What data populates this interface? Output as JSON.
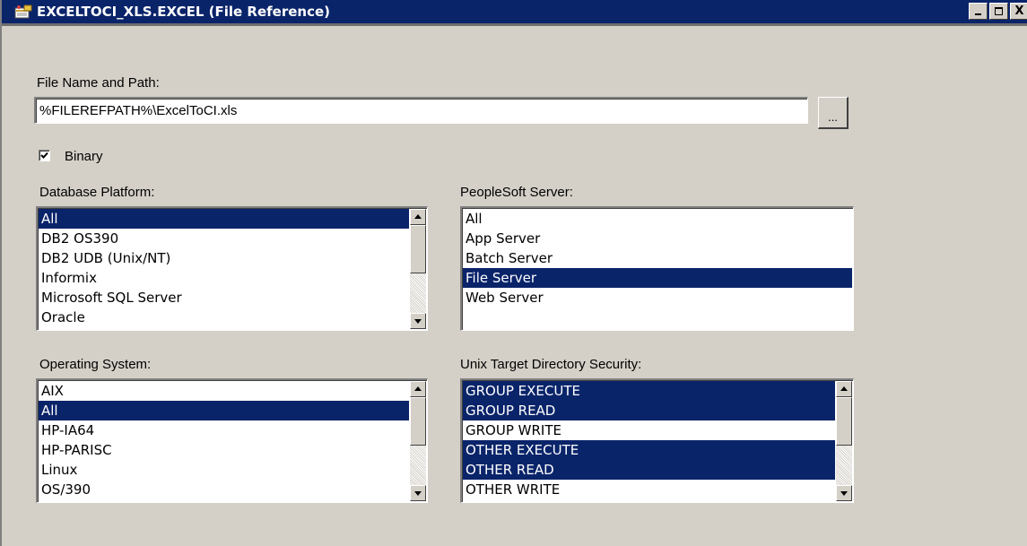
{
  "window": {
    "title": "EXCELTOCI_XLS.EXCEL (File Reference)",
    "controls": {
      "minimize": "_",
      "restore": "□",
      "close": "X"
    }
  },
  "file": {
    "label": "File Name and Path:",
    "value": "%FILEREFPATH%\\ExcelToCI.xls",
    "browse_label": "..."
  },
  "binary": {
    "label": "Binary",
    "checked": true
  },
  "database_platform": {
    "label": "Database Platform:",
    "items": [
      {
        "label": "All",
        "selected": true
      },
      {
        "label": "DB2 OS390",
        "selected": false
      },
      {
        "label": "DB2 UDB (Unix/NT)",
        "selected": false
      },
      {
        "label": "Informix",
        "selected": false
      },
      {
        "label": "Microsoft SQL Server",
        "selected": false
      },
      {
        "label": "Oracle",
        "selected": false
      }
    ]
  },
  "peoplesoft_server": {
    "label": "PeopleSoft Server:",
    "items": [
      {
        "label": "All",
        "selected": false
      },
      {
        "label": "App Server",
        "selected": false
      },
      {
        "label": "Batch Server",
        "selected": false
      },
      {
        "label": "File Server",
        "selected": true
      },
      {
        "label": "Web Server",
        "selected": false
      }
    ]
  },
  "operating_system": {
    "label": "Operating System:",
    "items": [
      {
        "label": "AIX",
        "selected": false
      },
      {
        "label": "All",
        "selected": true
      },
      {
        "label": "HP-IA64",
        "selected": false
      },
      {
        "label": "HP-PARISC",
        "selected": false
      },
      {
        "label": "Linux",
        "selected": false
      },
      {
        "label": "OS/390",
        "selected": false
      }
    ]
  },
  "unix_security": {
    "label": "Unix Target Directory Security:",
    "items": [
      {
        "label": "GROUP EXECUTE",
        "selected": true
      },
      {
        "label": "GROUP READ",
        "selected": true
      },
      {
        "label": "GROUP WRITE",
        "selected": false
      },
      {
        "label": "OTHER EXECUTE",
        "selected": true
      },
      {
        "label": "OTHER READ",
        "selected": true
      },
      {
        "label": "OTHER WRITE",
        "selected": false
      }
    ]
  },
  "colors": {
    "selection": "#0a246a",
    "dialog": "#d4d0c8",
    "titlebar": "#0a246a"
  }
}
